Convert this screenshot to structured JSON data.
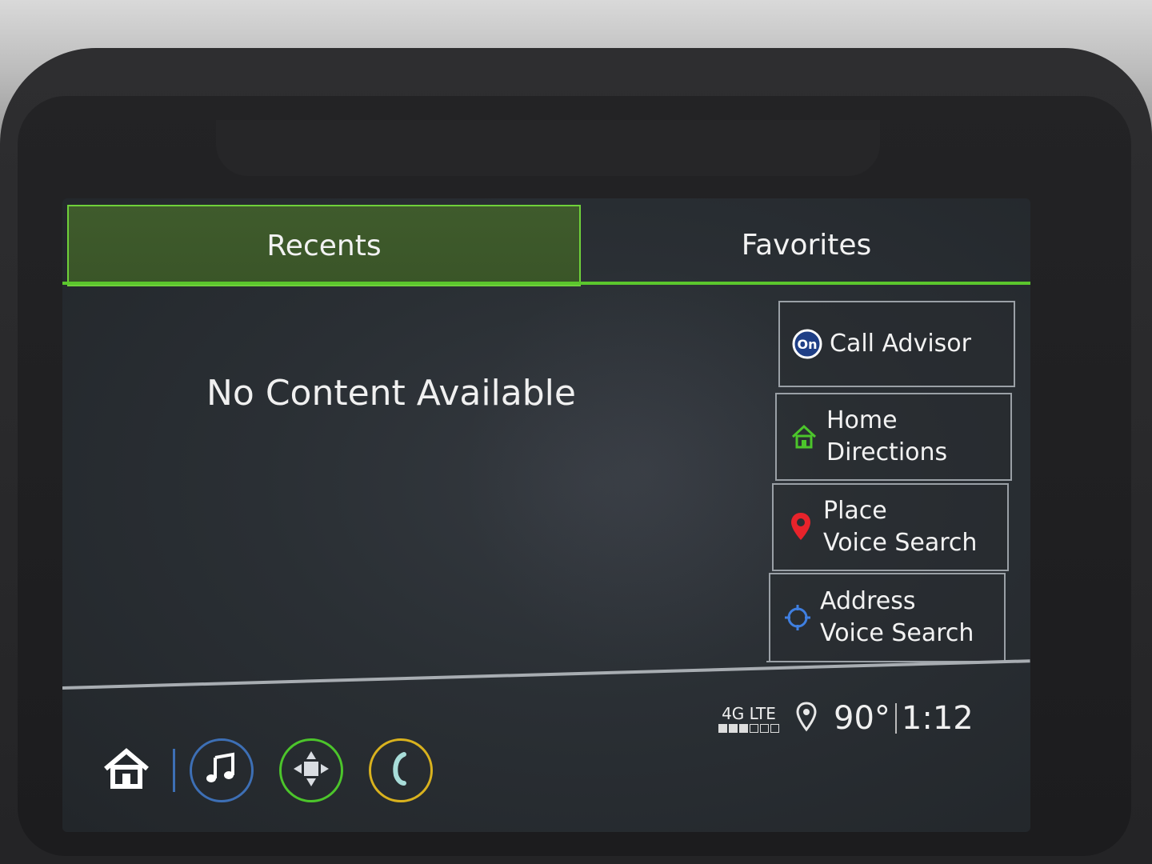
{
  "tabs": [
    {
      "label": "Recents",
      "active": true
    },
    {
      "label": "Favorites",
      "active": false
    }
  ],
  "main": {
    "empty_message": "No Content Available"
  },
  "quick_actions": [
    {
      "line1": "Call Advisor",
      "line2": "",
      "icon": "onstar-icon"
    },
    {
      "line1": "Home",
      "line2": "Directions",
      "icon": "home-icon"
    },
    {
      "line1": "Place",
      "line2": "Voice Search",
      "icon": "map-pin-icon"
    },
    {
      "line1": "Address",
      "line2": "Voice Search",
      "icon": "crosshair-icon"
    }
  ],
  "status": {
    "network": "4G LTE",
    "signal_bars": 3,
    "signal_total": 6,
    "temperature": "90°",
    "time": "1:12"
  },
  "bottom_nav": [
    "home-icon",
    "music-icon",
    "navigation-icon",
    "phone-icon"
  ],
  "colors": {
    "accent_green": "#5bc62d",
    "music_ring": "#3d6fb5",
    "nav_ring": "#4cc52b",
    "phone_ring": "#d9b21e",
    "pin_red": "#e8232b",
    "crosshair_blue": "#3f7fe0"
  }
}
